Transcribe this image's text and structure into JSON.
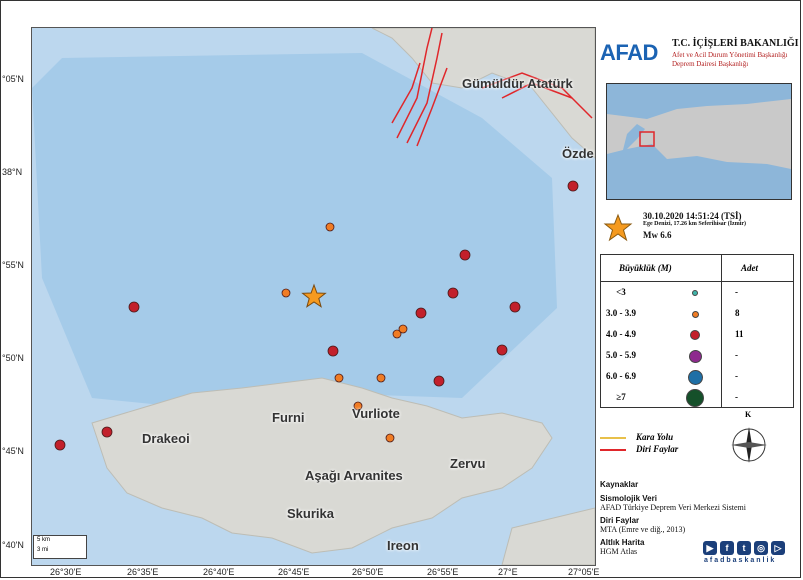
{
  "map": {
    "latitude_labels": [
      "°05'N",
      "38°N",
      "°55'N",
      "°50'N",
      "°45'N",
      "°40'N"
    ],
    "longitude_labels": [
      "26°30'E",
      "26°35'E",
      "26°40'E",
      "26°45'E",
      "26°50'E",
      "26°55'E",
      "27°E",
      "27°05'E"
    ],
    "places": [
      "Gümüldür Atatürk",
      "Özde",
      "Furni",
      "Vurliote",
      "Drakeoi",
      "Aşağı Arvanites",
      "Zervu",
      "Skurika",
      "Ireon"
    ],
    "scale": {
      "km": "5 km",
      "mi": "3 mi"
    },
    "colors": {
      "sea": "#bcd7ee",
      "deep_sea": "#9fc6e8",
      "land": "#d9d9d4",
      "fault": "#e0272b",
      "road": "#e8c04a",
      "epicenter": "#f59a1f",
      "mag_3_39": "#f07c24",
      "mag_4_49": "#c2202b"
    }
  },
  "header": {
    "logo": "AFAD",
    "ministry": "T.C. İÇİŞLERİ BAKANLIĞI",
    "sub1": "Afet ve Acil Durum Yönetimi Başkanlığı",
    "sub2": "Deprem Dairesi Başkanlığı"
  },
  "event": {
    "datetime": "30.10.2020 14:51:24 (TSİ)",
    "location": "Ege Denizi, 17.26 km Seferihisar (İzmir)",
    "magnitude": "Mw 6.6"
  },
  "legend": {
    "col_magnitude": "Büyüklük (M)",
    "col_count": "Adet",
    "rows": [
      {
        "range": "<3",
        "color": "#3fb3a8",
        "count": "-"
      },
      {
        "range": "3.0 - 3.9",
        "color": "#f07c24",
        "count": "8"
      },
      {
        "range": "4.0 - 4.9",
        "color": "#c2202b",
        "count": "11"
      },
      {
        "range": "5.0 - 5.9",
        "color": "#8e2a8e",
        "count": "-"
      },
      {
        "range": "6.0 - 6.9",
        "color": "#1f6fa6",
        "count": "-"
      },
      {
        "range": "≥7",
        "color": "#15502a",
        "count": "-"
      }
    ]
  },
  "lines": {
    "road": "Kara Yolu",
    "fault": "Diri Faylar"
  },
  "north": "K",
  "sources": {
    "title": "Kaynaklar",
    "seis_title": "Sismolojik Veri",
    "seis": "AFAD Türkiye Deprem Veri Merkezi Sistemi",
    "fault_title": "Diri Faylar",
    "fault": "MTA (Emre ve diğ., 2013)",
    "base_title": "Altlık Harita",
    "base": "HGM Atlas"
  },
  "footer_handle": "afadbaskanlik",
  "social_icons": [
    "youtube-icon",
    "facebook-icon",
    "twitter-icon",
    "instagram-icon",
    "youtube-play-icon"
  ]
}
